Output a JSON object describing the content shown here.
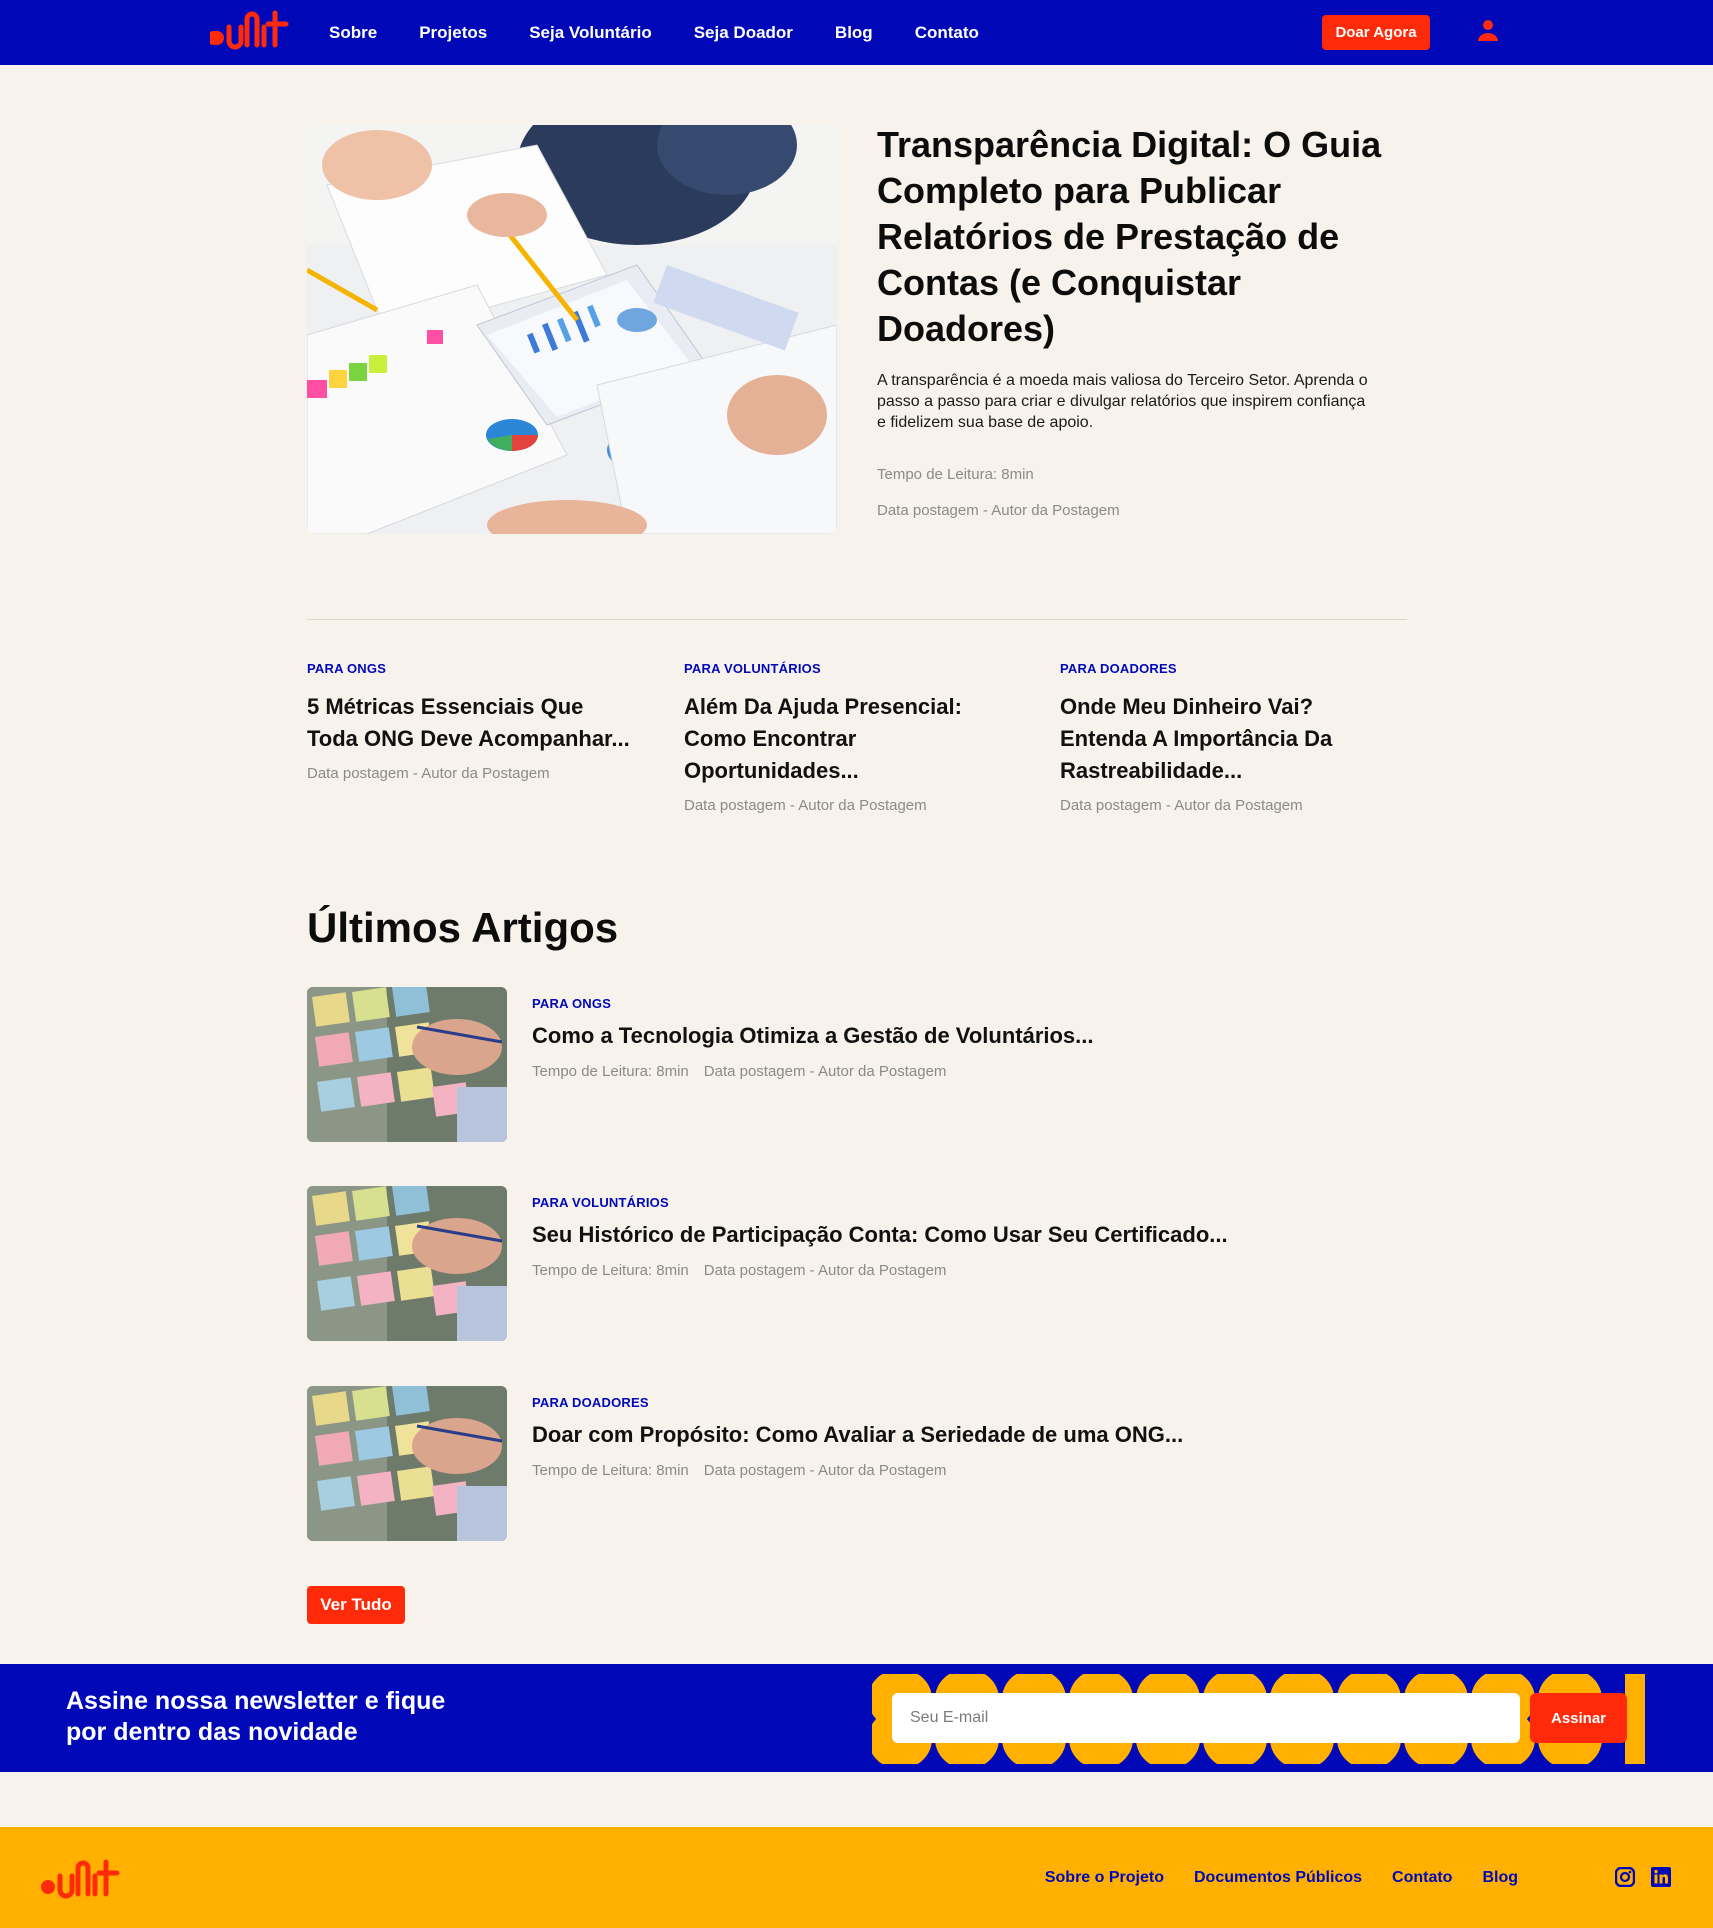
{
  "header": {
    "logo_alt": "logo",
    "nav": [
      "Sobre",
      "Projetos",
      "Seja Voluntário",
      "Seja Doador",
      "Blog",
      "Contato"
    ],
    "donate_label": "Doar Agora",
    "user_icon": "user-icon"
  },
  "hero": {
    "title": "Transparência Digital: O Guia Completo para Publicar Relatórios de Prestação de Contas (e Conquistar Doadores)",
    "excerpt": "A transparência é a moeda mais valiosa do Terceiro Setor. Aprenda o passo a passo para criar e divulgar relatórios que inspirem confiança e fidelizem sua base de apoio.",
    "reading_time": "Tempo de Leitura: 8min",
    "meta": "Data postagem - Autor da Postagem"
  },
  "featured": [
    {
      "category": "Para ONGS",
      "title": "5 Métricas Essenciais Que Toda ONG Deve Acompanhar...",
      "meta": "Data postagem - Autor da Postagem"
    },
    {
      "category": "Para Voluntários",
      "title": "Além Da Ajuda Presencial: Como Encontrar Oportunidades...",
      "meta": "Data postagem - Autor da Postagem"
    },
    {
      "category": "Para Doadores",
      "title": "Onde Meu Dinheiro Vai? Entenda A Importância Da Rastreabilidade...",
      "meta": "Data postagem - Autor da Postagem"
    }
  ],
  "latest": {
    "heading": "Últimos Artigos",
    "articles": [
      {
        "category": "Para ONGS",
        "title": "Como a Tecnologia Otimiza a Gestão de Voluntários...",
        "reading_time": "Tempo de Leitura: 8min",
        "meta": "Data postagem - Autor da Postagem"
      },
      {
        "category": "Para Voluntários",
        "title": "Seu Histórico de Participação Conta: Como Usar Seu Certificado...",
        "reading_time": "Tempo de Leitura: 8min",
        "meta": "Data postagem - Autor da Postagem"
      },
      {
        "category": "Para Doadores",
        "title": "Doar com Propósito: Como Avaliar a Seriedade de uma ONG...",
        "reading_time": "Tempo de Leitura: 8min",
        "meta": "Data postagem - Autor da Postagem"
      }
    ],
    "see_all_label": "Ver Tudo"
  },
  "newsletter": {
    "heading": "Assine nossa newsletter e fique por dentro das novidade",
    "email_placeholder": "Seu E-mail",
    "subscribe_label": "Assinar"
  },
  "footer": {
    "nav": [
      "Sobre o Projeto",
      "Documentos Públicos",
      "Contato",
      "Blog"
    ],
    "social": [
      "instagram-icon",
      "linkedin-icon"
    ]
  },
  "colors": {
    "brand_blue": "#0008b8",
    "brand_red": "#ff2a0a",
    "brand_yellow": "#ffb000",
    "background": "#f7f3ec"
  }
}
